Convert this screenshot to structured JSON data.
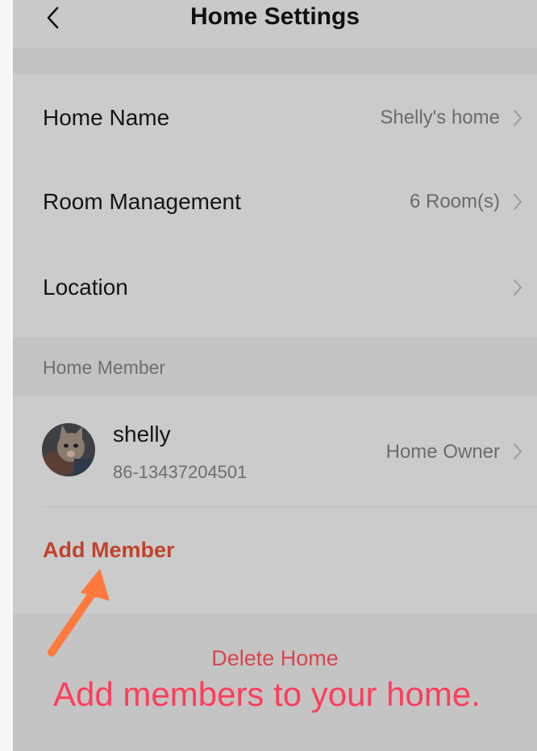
{
  "header": {
    "title": "Home Settings",
    "back_icon": "chevron-left-icon"
  },
  "settings": {
    "home_name": {
      "label": "Home Name",
      "value": "Shelly's home"
    },
    "room_management": {
      "label": "Room Management",
      "value": "6 Room(s)"
    },
    "location": {
      "label": "Location",
      "value": ""
    }
  },
  "members_section": {
    "title": "Home Member",
    "members": [
      {
        "name": "shelly",
        "phone": "86-13437204501",
        "role": "Home Owner",
        "avatar": "cat-avatar"
      }
    ],
    "add_label": "Add Member"
  },
  "delete_home_label": "Delete Home",
  "overlay": {
    "caption": "Add members to your home.",
    "arrow": "orange-arrow-icon"
  },
  "colors": {
    "accent": "#c0432b",
    "delete": "#d9464e",
    "caption": "#ff3e5a",
    "arrow": "#ff7a3c"
  }
}
